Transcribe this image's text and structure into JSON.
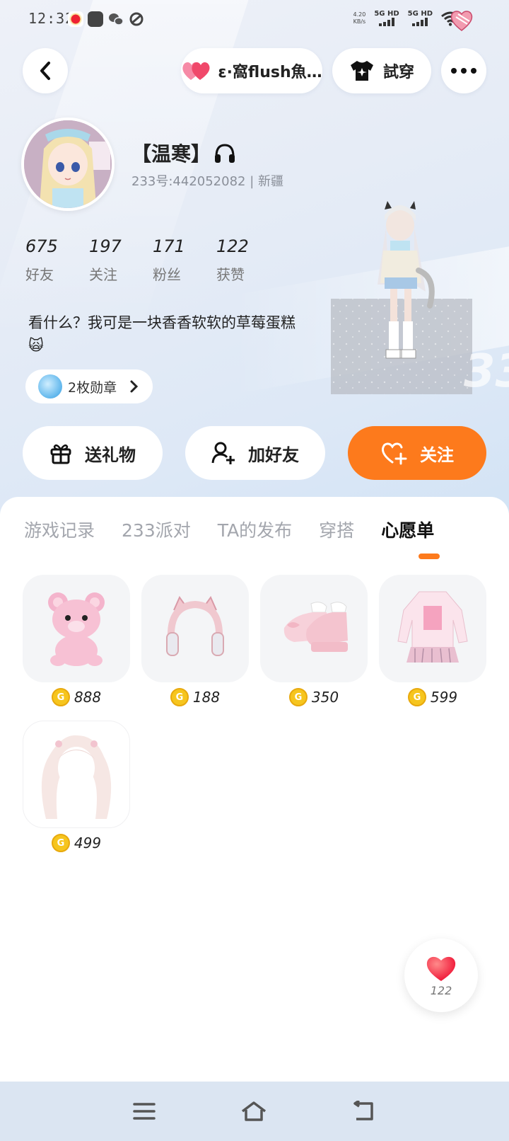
{
  "status_bar": {
    "time": "12:32",
    "net_speed_value": "4.20",
    "net_speed_unit": "KB/s",
    "sim1": "5G HD",
    "sim2": "5G HD"
  },
  "header": {
    "partner_name": "ε·窩flush魚…",
    "tryon_label": "試穿"
  },
  "profile": {
    "username": "【温寒】",
    "user_id": "233号:44205208​2 | 新疆",
    "stats": [
      {
        "value": "675",
        "label": "好友"
      },
      {
        "value": "197",
        "label": "关注"
      },
      {
        "value": "171",
        "label": "粉丝"
      },
      {
        "value": "122",
        "label": "获赞"
      }
    ],
    "bio": "看什么？我可是一块香香软软的草莓蛋糕",
    "bio_emoji": "🙀",
    "medal_label": "2枚勋章"
  },
  "actions": {
    "gift": "送礼物",
    "add_friend": "加好友",
    "follow": "关注"
  },
  "tabs": [
    {
      "label": "游戏记录",
      "active": false
    },
    {
      "label": "233派对",
      "active": false
    },
    {
      "label": "TA的发布",
      "active": false
    },
    {
      "label": "穿搭",
      "active": false
    },
    {
      "label": "心愿单",
      "active": true
    }
  ],
  "wishlist": [
    {
      "name": "pink-bear",
      "price": "888"
    },
    {
      "name": "cat-ear-headphones",
      "price": "188"
    },
    {
      "name": "pink-shoes",
      "price": "350"
    },
    {
      "name": "pink-outfit",
      "price": "599"
    },
    {
      "name": "twin-tail-hair",
      "price": "499"
    }
  ],
  "coin_symbol": "G",
  "like_count": "122",
  "colors": {
    "accent": "#fd7a1c",
    "coin": "#f6c51e",
    "heart": "#f0486a"
  }
}
